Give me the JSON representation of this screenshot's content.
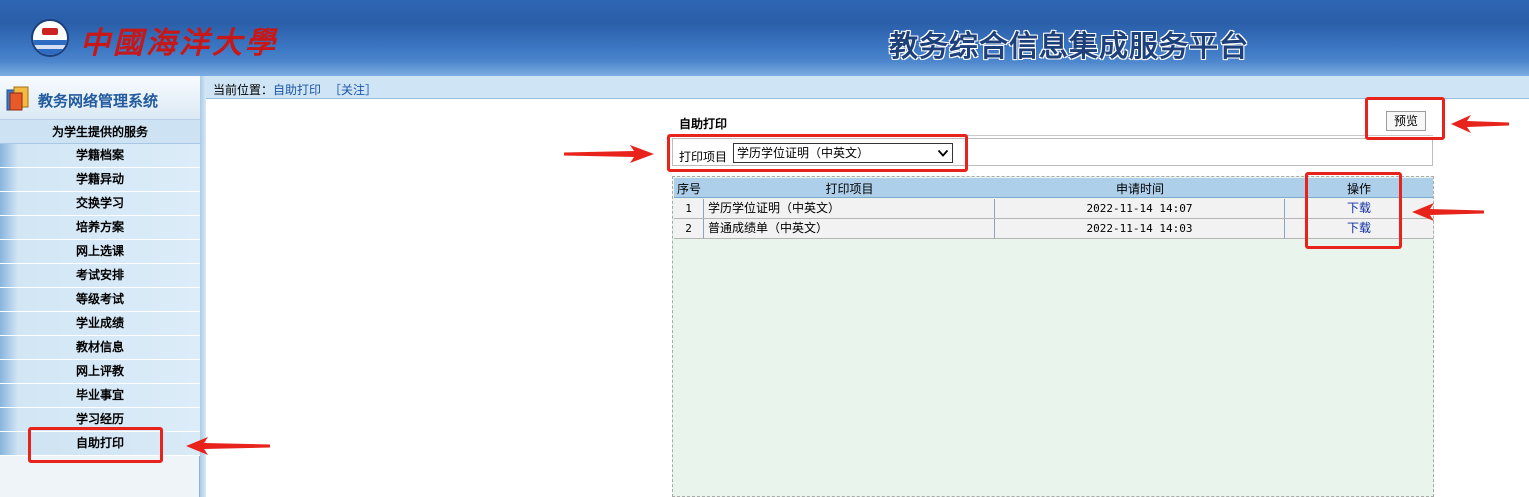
{
  "header": {
    "school_name": "中國海洋大學",
    "platform_title": "教务综合信息集成服务平台"
  },
  "sidebar": {
    "system_title": "教务网络管理系统",
    "section_title": "为学生提供的服务",
    "items": [
      {
        "label": "学籍档案"
      },
      {
        "label": "学籍异动"
      },
      {
        "label": "交换学习"
      },
      {
        "label": "培养方案"
      },
      {
        "label": "网上选课"
      },
      {
        "label": "考试安排"
      },
      {
        "label": "等级考试"
      },
      {
        "label": "学业成绩"
      },
      {
        "label": "教材信息"
      },
      {
        "label": "网上评教"
      },
      {
        "label": "毕业事宜"
      },
      {
        "label": "学习经历"
      },
      {
        "label": "自助打印"
      }
    ],
    "active_item": "自助打印"
  },
  "location": {
    "prefix": "当前位置：",
    "current": "自助打印",
    "follow": "［关注］"
  },
  "main": {
    "panel_title": "自助打印",
    "preview_button": "预览",
    "filter": {
      "label": "打印项目",
      "selected": "学历学位证明（中英文）"
    },
    "table": {
      "headers": {
        "no": "序号",
        "item": "打印项目",
        "time": "申请时间",
        "op": "操作"
      },
      "rows": [
        {
          "no": "1",
          "item": "学历学位证明（中英文）",
          "time": "2022-11-14 14:07",
          "op": "下载"
        },
        {
          "no": "2",
          "item": "普通成绩单（中英文）",
          "time": "2022-11-14 14:03",
          "op": "下载"
        }
      ]
    }
  },
  "colors": {
    "header_blue": "#2f66b3",
    "annotation_red": "#e8231c",
    "school_red": "#c81717",
    "table_bg": "#e9f5ec"
  }
}
